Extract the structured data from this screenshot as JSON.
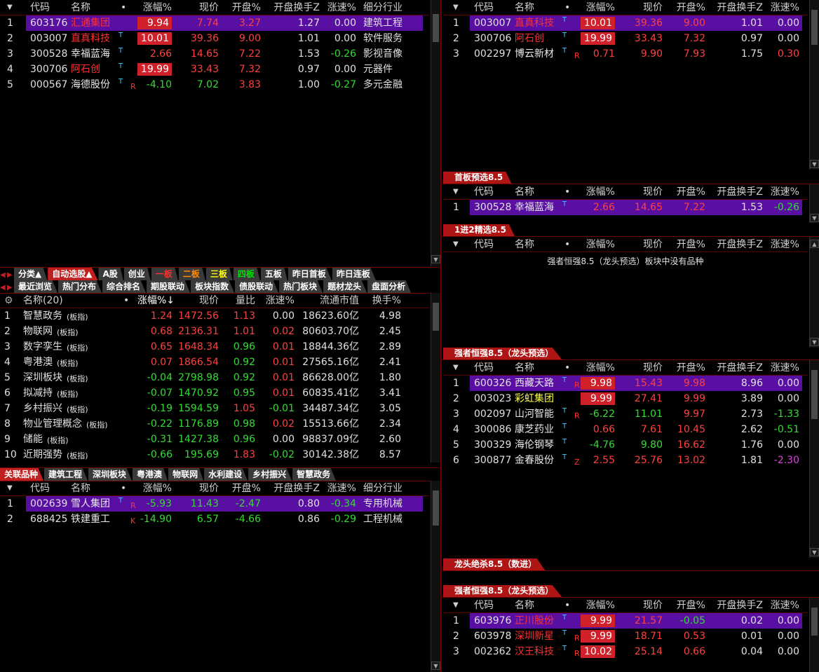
{
  "colors": {
    "accent": "#c02020",
    "selected": "#5a0fa3",
    "up": "#ff4040",
    "down": "#33dd33"
  },
  "hdr_stock": {
    "arrow": "▼",
    "code": "代码",
    "name": "名称",
    "dot": "•",
    "pct": "涨幅%",
    "price": "现价",
    "open": "开盘%",
    "turn": "开盘换手Z",
    "speed": "涨速%",
    "ind": "细分行业"
  },
  "top_left": {
    "rows": [
      {
        "no": "1",
        "code": "603176",
        "name": "汇通集团",
        "pct": "9.94",
        "price": "7.74",
        "open": "3.27",
        "turn": "1.27",
        "speed": "0.00",
        "ind": "建筑工程",
        "sel": true,
        "nc": "nm-red",
        "pc": "up",
        "oc": "up",
        "sc": "fl",
        "box": true
      },
      {
        "no": "2",
        "code": "003007",
        "name": "直真科技",
        "t": "T",
        "pct": "10.01",
        "price": "39.36",
        "open": "9.00",
        "turn": "1.01",
        "speed": "0.00",
        "ind": "软件服务",
        "nc": "nm-red",
        "pc": "up",
        "oc": "up",
        "sc": "fl",
        "box": true
      },
      {
        "no": "3",
        "code": "300528",
        "name": "幸福蓝海",
        "t": "T",
        "pct": "2.66",
        "price": "14.65",
        "open": "7.22",
        "turn": "1.53",
        "speed": "-0.26",
        "ind": "影视音像",
        "nc": "nm-wht",
        "pc": "up",
        "oc": "up",
        "sc": "dn"
      },
      {
        "no": "4",
        "code": "300706",
        "name": "阿石创",
        "t": "T",
        "pct": "19.99",
        "price": "33.43",
        "open": "7.32",
        "turn": "0.97",
        "speed": "0.00",
        "ind": "元器件",
        "nc": "nm-red",
        "pc": "up",
        "oc": "up",
        "sc": "fl",
        "box": true
      },
      {
        "no": "5",
        "code": "000567",
        "name": "海德股份",
        "t": "T",
        "flag": "R",
        "pct": "-4.10",
        "price": "7.02",
        "open": "3.83",
        "turn": "1.00",
        "speed": "-0.27",
        "ind": "多元金融",
        "nc": "nm-wht",
        "pc": "dn",
        "oc": "up",
        "sc": "dn"
      }
    ]
  },
  "top_right": {
    "rows": [
      {
        "no": "1",
        "code": "003007",
        "name": "直真科技",
        "t": "T",
        "pct": "10.01",
        "price": "39.36",
        "open": "9.00",
        "turn": "1.01",
        "speed": "0.00",
        "sel": true,
        "nc": "nm-red",
        "pc": "up",
        "oc": "up",
        "sc": "fl",
        "box": true
      },
      {
        "no": "2",
        "code": "300706",
        "name": "阿石创",
        "t": "T",
        "pct": "19.99",
        "price": "33.43",
        "open": "7.32",
        "turn": "0.97",
        "speed": "0.00",
        "nc": "nm-red",
        "pc": "up",
        "oc": "up",
        "sc": "fl",
        "box": true
      },
      {
        "no": "3",
        "code": "002297",
        "name": "博云新材",
        "t": "T",
        "flag": "R",
        "pct": "0.71",
        "price": "9.90",
        "open": "7.93",
        "turn": "1.75",
        "speed": "0.30",
        "nc": "nm-wht",
        "pc": "up",
        "oc": "up",
        "sc": "up"
      }
    ]
  },
  "panel2": {
    "title": "首板预选8.5",
    "rows": [
      {
        "no": "1",
        "code": "300528",
        "name": "幸福蓝海",
        "t": "T",
        "pct": "2.66",
        "price": "14.65",
        "open": "7.22",
        "turn": "1.53",
        "speed": "-0.26",
        "sel": true,
        "nc": "nm-wht",
        "pc": "up",
        "oc": "up",
        "sc": "dn"
      }
    ]
  },
  "panel3": {
    "title": "1进2精选8.5",
    "empty": "强者恒强8.5（龙头预选）板块中没有品种"
  },
  "panel4": {
    "title": "强者恒强8.5（龙头预选）",
    "rows": [
      {
        "no": "1",
        "code": "600326",
        "name": "西藏天路",
        "t": "T",
        "flag": "R",
        "pct": "9.98",
        "price": "15.43",
        "open": "9.98",
        "turn": "8.96",
        "speed": "0.00",
        "sel": true,
        "nc": "nm-wht",
        "pc": "up",
        "oc": "up",
        "sc": "fl",
        "box": true
      },
      {
        "no": "2",
        "code": "003023",
        "name": "彩虹集团",
        "pct": "9.99",
        "price": "27.41",
        "open": "9.99",
        "turn": "3.89",
        "speed": "0.00",
        "nc": "nm-yel",
        "pc": "up",
        "oc": "up",
        "sc": "fl",
        "box": true
      },
      {
        "no": "3",
        "code": "002097",
        "name": "山河智能",
        "t": "T",
        "flag": "R",
        "pct": "-6.22",
        "price": "11.01",
        "open": "9.97",
        "turn": "2.73",
        "speed": "-1.33",
        "nc": "nm-wht",
        "pc": "dn",
        "oc": "up",
        "sc": "dn"
      },
      {
        "no": "4",
        "code": "300086",
        "name": "康芝药业",
        "t": "T",
        "pct": "0.66",
        "price": "7.61",
        "open": "10.45",
        "turn": "2.62",
        "speed": "-0.51",
        "nc": "nm-wht",
        "pc": "up",
        "oc": "up",
        "sc": "dn"
      },
      {
        "no": "5",
        "code": "300329",
        "name": "海伦钢琴",
        "t": "T",
        "pct": "-4.76",
        "price": "9.80",
        "open": "16.62",
        "turn": "1.76",
        "speed": "0.00",
        "nc": "nm-wht",
        "pc": "dn",
        "oc": "up",
        "sc": "fl"
      },
      {
        "no": "6",
        "code": "300877",
        "name": "金春股份",
        "t": "T",
        "flag": "Z",
        "pct": "2.55",
        "price": "25.76",
        "open": "13.02",
        "turn": "1.81",
        "speed": "-2.30",
        "nc": "nm-wht",
        "pc": "up",
        "oc": "up",
        "sc": "mag"
      }
    ]
  },
  "panel5": {
    "title": "龙头绝杀8.5（数进）"
  },
  "panel6": {
    "title": "强者恒强8.5（龙头预选）",
    "rows": [
      {
        "no": "1",
        "code": "603976",
        "name": "正川股份",
        "t": "T",
        "pct": "9.99",
        "price": "21.57",
        "open": "-0.05",
        "turn": "0.02",
        "speed": "0.00",
        "sel": true,
        "nc": "nm-red",
        "pc": "up",
        "oc": "dn",
        "sc": "fl",
        "box": true
      },
      {
        "no": "2",
        "code": "603978",
        "name": "深圳新星",
        "t": "T",
        "flag": "R",
        "pct": "9.99",
        "price": "18.71",
        "open": "0.53",
        "turn": "0.01",
        "speed": "0.00",
        "nc": "nm-red",
        "pc": "up",
        "oc": "up",
        "sc": "fl",
        "box": true
      },
      {
        "no": "3",
        "code": "002362",
        "name": "汉王科技",
        "t": "T",
        "flag": "R",
        "pct": "10.02",
        "price": "25.14",
        "open": "0.66",
        "turn": "0.04",
        "speed": "0.00",
        "nc": "nm-red",
        "pc": "up",
        "oc": "up",
        "sc": "fl",
        "box": true
      }
    ]
  },
  "tabs1": [
    {
      "l": "分类▲"
    },
    {
      "l": "自动选股▲",
      "act": true
    },
    {
      "l": "A股"
    },
    {
      "l": "创业"
    },
    {
      "l": "一板",
      "c": "red"
    },
    {
      "l": "二板",
      "c": "org"
    },
    {
      "l": "三板",
      "c": "yel"
    },
    {
      "l": "四板",
      "c": "grn"
    },
    {
      "l": "五板"
    },
    {
      "l": "昨日首板"
    },
    {
      "l": "昨日连板"
    }
  ],
  "tabs2": [
    {
      "l": "最近浏览"
    },
    {
      "l": "热门分布"
    },
    {
      "l": "综合排名"
    },
    {
      "l": "期股联动"
    },
    {
      "l": "板块指数"
    },
    {
      "l": "债股联动"
    },
    {
      "l": "热门板块"
    },
    {
      "l": "题材龙头"
    },
    {
      "l": "盘面分析"
    }
  ],
  "sector": {
    "hdr": {
      "name": "名称(20)",
      "dot": "•",
      "pct": "涨幅%↓",
      "price": "现价",
      "vr": "量比",
      "speed": "涨速%",
      "mcap": "流通市值",
      "turn": "换手%"
    },
    "tag": "(板指)",
    "rows": [
      {
        "no": "1",
        "name": "智慧政务",
        "pct": "1.24",
        "price": "1472.56",
        "vr": "1.13",
        "speed": "0.00",
        "mcap": "18623.60亿",
        "turn": "4.98",
        "pc": "up",
        "sc": "fl"
      },
      {
        "no": "2",
        "name": "物联网",
        "pct": "0.68",
        "price": "2136.31",
        "vr": "1.01",
        "speed": "0.02",
        "mcap": "80603.70亿",
        "turn": "2.45",
        "pc": "up",
        "sc": "up"
      },
      {
        "no": "3",
        "name": "数字孪生",
        "pct": "0.65",
        "price": "1648.34",
        "vr": "0.96",
        "speed": "0.01",
        "mcap": "18844.36亿",
        "turn": "2.89",
        "pc": "up",
        "sc": "up"
      },
      {
        "no": "4",
        "name": "粤港澳",
        "pct": "0.07",
        "price": "1866.54",
        "vr": "0.92",
        "speed": "0.01",
        "mcap": "27565.16亿",
        "turn": "2.41",
        "pc": "up",
        "sc": "up"
      },
      {
        "no": "5",
        "name": "深圳板块",
        "pct": "-0.04",
        "price": "2798.98",
        "vr": "0.92",
        "speed": "0.01",
        "mcap": "86628.00亿",
        "turn": "1.80",
        "pc": "dn",
        "sc": "up"
      },
      {
        "no": "6",
        "name": "拟减持",
        "pct": "-0.07",
        "price": "1470.92",
        "vr": "0.95",
        "speed": "0.01",
        "mcap": "60835.41亿",
        "turn": "3.41",
        "pc": "dn",
        "sc": "up"
      },
      {
        "no": "7",
        "name": "乡村振兴",
        "pct": "-0.19",
        "price": "1594.59",
        "vr": "1.05",
        "speed": "-0.01",
        "mcap": "34487.34亿",
        "turn": "3.05",
        "pc": "dn",
        "sc": "dn"
      },
      {
        "no": "8",
        "name": "物业管理概念",
        "pct": "-0.22",
        "price": "1176.89",
        "vr": "0.98",
        "speed": "0.02",
        "mcap": "15513.66亿",
        "turn": "2.34",
        "pc": "dn",
        "sc": "up"
      },
      {
        "no": "9",
        "name": "储能",
        "pct": "-0.31",
        "price": "1427.38",
        "vr": "0.96",
        "speed": "0.00",
        "mcap": "98837.09亿",
        "turn": "2.60",
        "pc": "dn",
        "sc": "fl"
      },
      {
        "no": "10",
        "name": "近期强势",
        "pct": "-0.66",
        "price": "195.69",
        "vr": "1.83",
        "speed": "-0.02",
        "mcap": "30142.38亿",
        "turn": "8.57",
        "pc": "dn",
        "sc": "dn"
      }
    ]
  },
  "tabs3": [
    {
      "l": "关联品种",
      "act": true
    },
    {
      "l": "建筑工程"
    },
    {
      "l": "深圳板块"
    },
    {
      "l": "粤港澳"
    },
    {
      "l": "物联网"
    },
    {
      "l": "水利建设"
    },
    {
      "l": "乡村振兴"
    },
    {
      "l": "智慧政务"
    }
  ],
  "related": {
    "rows": [
      {
        "no": "1",
        "code": "002639",
        "name": "雪人集团",
        "t": "T",
        "flag": "R",
        "pct": "-5.93",
        "price": "11.43",
        "open": "-2.47",
        "turn": "0.80",
        "speed": "-0.34",
        "ind": "专用机械",
        "sel": true,
        "nc": "nm-wht",
        "pc": "dn",
        "oc": "dn",
        "sc": "dn"
      },
      {
        "no": "2",
        "code": "688425",
        "name": "铁建重工",
        "flag": "K",
        "pct": "-14.90",
        "price": "6.57",
        "open": "-4.66",
        "turn": "0.86",
        "speed": "-0.29",
        "ind": "工程机械",
        "nc": "nm-wht",
        "pc": "dn",
        "oc": "dn",
        "sc": "dn"
      }
    ]
  }
}
